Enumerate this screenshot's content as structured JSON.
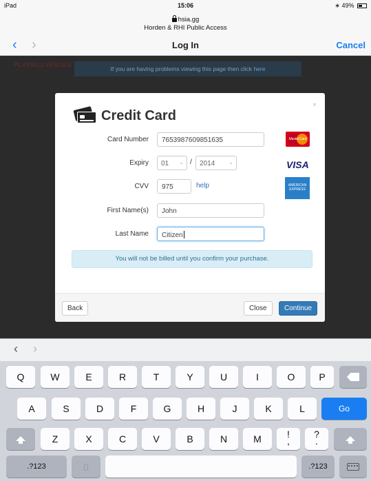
{
  "status_bar": {
    "device": "iPad",
    "time": "15:06",
    "battery": "49%"
  },
  "url_bar": {
    "domain": "hsia.gg",
    "page_title": "Horden & RHI Public Access"
  },
  "nav_bar": {
    "title": "Log In",
    "cancel_label": "Cancel"
  },
  "webpage": {
    "logo_text": "PLAYBILLVENUES",
    "notice_text": "If you are having problems viewing this page then click",
    "notice_link": "here"
  },
  "modal": {
    "title": "Credit Card",
    "card_number_label": "Card Number",
    "card_number_value": "7653987609851635",
    "expiry_label": "Expiry",
    "expiry_month": "01",
    "expiry_separator": "/",
    "expiry_year": "2014",
    "cvv_label": "CVV",
    "cvv_value": "975",
    "help_link": "help",
    "first_name_label": "First Name(s)",
    "first_name_value": "John",
    "last_name_label": "Last Name",
    "last_name_value": "Citizen",
    "info_message": "You will not be billed until you confirm your purchase.",
    "back_button": "Back",
    "close_button": "Close",
    "continue_button": "Continue",
    "close_icon": "×",
    "brands": {
      "mastercard": "MasterCard",
      "visa": "VISA",
      "amex": "AMERICAN EXPRESS"
    }
  },
  "keyboard": {
    "row1": [
      "Q",
      "W",
      "E",
      "R",
      "T",
      "Y",
      "U",
      "I",
      "O",
      "P"
    ],
    "row2": [
      "A",
      "S",
      "D",
      "F",
      "G",
      "H",
      "J",
      "K",
      "L"
    ],
    "row3": [
      "Z",
      "X",
      "C",
      "V",
      "B",
      "N",
      "M"
    ],
    "go_label": "Go",
    "numbers_label": ".?123",
    "excl_top": "!",
    "excl_bottom": ",",
    "question_top": "?",
    "question_bottom": "."
  },
  "colors": {
    "ios_blue": "#1a7ef2",
    "primary_button": "#337ab7",
    "info_bg": "#d9edf7"
  }
}
